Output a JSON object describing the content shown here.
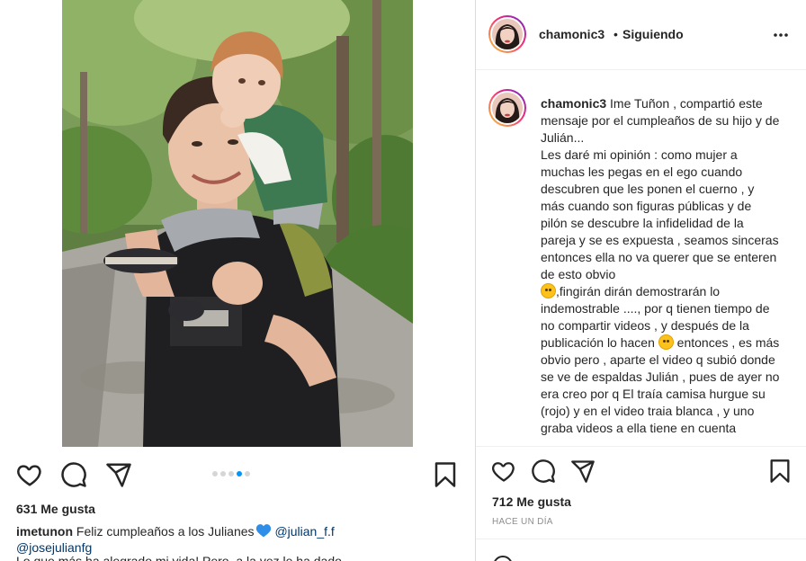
{
  "post": {
    "username": "chamonic3",
    "follow_status": "Siguiendo",
    "separator": "•",
    "photo_alt": "young man carrying a child on his shoulders"
  },
  "left": {
    "likes": "631 Me gusta",
    "carousel": {
      "count": 5,
      "active_index": 3
    },
    "caption_user": "imetunon",
    "caption_text": " Feliz cumpleaños a los Julianes",
    "caption_mention1": "@julian_f.f",
    "caption_mention2": "@josejulianfg",
    "caption_cut": "Lo que más ha alegrado mi vida! Pero, a la vez le ha dado..."
  },
  "comment": {
    "username": "chamonic3",
    "text_part1": " Ime Tuñon , compartió este mensaje por el cumpleaños de su hijo y de Julián...\nLes daré mi opinión : como mujer a muchas les pegas en el ego cuando descubren que les ponen el cuerno , y más cuando son figuras públicas y de pilón se descubre la infidelidad de la pareja y se es expuesta , seamos sinceras entonces ella no va querer que se enteren de esto obvio\n",
    "text_part2": ",fingirán dirán demostrarán lo indemostrable ...., por q tienen tiempo de no compartir videos , y después de la publicación lo hacen ",
    "text_part3": " entonces , es más obvio pero , aparte el video q subió donde se ve de espaldas Julián , pues de ayer no era creo por q El traía camisa hurgue su (rojo) y en el video traia blanca , y uno graba videos a ella tiene en cuenta"
  },
  "right": {
    "likes": "712 Me gusta",
    "time": "HACE UN DÍA"
  },
  "icons": {
    "like": "heart-icon",
    "comment": "comment-bubble-icon",
    "share": "paper-plane-icon",
    "save": "bookmark-icon",
    "more": "more-dots-icon",
    "heart_emoji": "blue-heart-emoji"
  },
  "colors": {
    "link": "#00376b",
    "active_dot": "#0095f6",
    "muted": "#8e8e8e",
    "text": "#262626",
    "border": "#dbdbdb"
  }
}
